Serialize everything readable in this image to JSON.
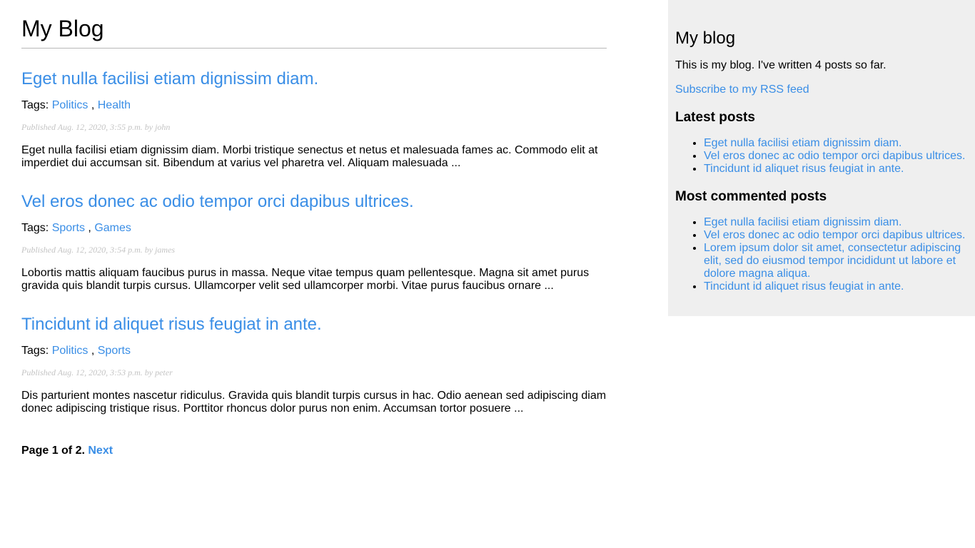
{
  "site": {
    "title": "My Blog"
  },
  "posts": [
    {
      "title": "Eget nulla facilisi etiam dignissim diam.",
      "tags_label": "Tags:",
      "tags": [
        "Politics",
        "Health"
      ],
      "published": "Published Aug. 12, 2020, 3:55 p.m. by john",
      "excerpt": "Eget nulla facilisi etiam dignissim diam. Morbi tristique senectus et netus et malesuada fames ac. Commodo elit at imperdiet dui accumsan sit. Bibendum at varius vel pharetra vel. Aliquam malesuada ..."
    },
    {
      "title": "Vel eros donec ac odio tempor orci dapibus ultrices.",
      "tags_label": "Tags:",
      "tags": [
        "Sports",
        "Games"
      ],
      "published": "Published Aug. 12, 2020, 3:54 p.m. by james",
      "excerpt": "Lobortis mattis aliquam faucibus purus in massa. Neque vitae tempus quam pellentesque. Magna sit amet purus gravida quis blandit turpis cursus. Ullamcorper velit sed ullamcorper morbi. Vitae purus faucibus ornare ..."
    },
    {
      "title": "Tincidunt id aliquet risus feugiat in ante.",
      "tags_label": "Tags:",
      "tags": [
        "Politics",
        "Sports"
      ],
      "published": "Published Aug. 12, 2020, 3:53 p.m. by peter",
      "excerpt": "Dis parturient montes nascetur ridiculus. Gravida quis blandit turpis cursus in hac. Odio aenean sed adipiscing diam donec adipiscing tristique risus. Porttitor rhoncus dolor purus non enim. Accumsan tortor posuere ..."
    }
  ],
  "pagination": {
    "text": "Page 1 of 2.",
    "next_label": "Next"
  },
  "sidebar": {
    "title": "My blog",
    "description": "This is my blog. I've written 4 posts so far.",
    "rss_label": "Subscribe to my RSS feed",
    "latest_heading": "Latest posts",
    "latest_posts": [
      "Eget nulla facilisi etiam dignissim diam.",
      "Vel eros donec ac odio tempor orci dapibus ultrices.",
      "Tincidunt id aliquet risus feugiat in ante."
    ],
    "most_commented_heading": "Most commented posts",
    "most_commented_posts": [
      "Eget nulla facilisi etiam dignissim diam.",
      "Vel eros donec ac odio tempor orci dapibus ultrices.",
      "Lorem ipsum dolor sit amet, consectetur adipiscing elit, sed do eiusmod tempor incididunt ut labore et dolore magna aliqua.",
      "Tincidunt id aliquet risus feugiat in ante."
    ]
  },
  "colors": {
    "link": "#3a8ee6",
    "sidebar_bg": "#efefef",
    "meta_text": "#c4c4c4"
  }
}
